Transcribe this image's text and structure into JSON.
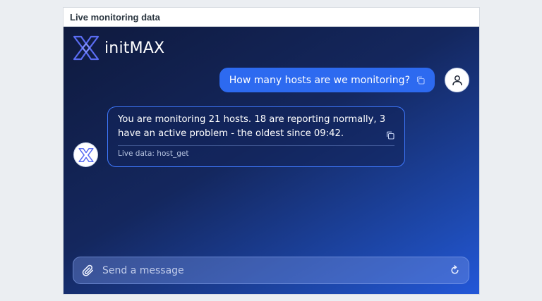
{
  "widget": {
    "title": "Live monitoring data"
  },
  "brand": {
    "name": "initMAX"
  },
  "conversation": {
    "user_message": "How many hosts are we monitoring?",
    "bot_message": "You are monitoring 21 hosts. 18 are reporting normally, 3 have an active problem - the oldest since 09:42.",
    "bot_source": "Live data: host_get"
  },
  "composer": {
    "placeholder": "Send a message"
  },
  "icons": {
    "logo": "initmax-logo-icon",
    "copy": "copy-icon",
    "user": "user-icon",
    "attach": "paperclip-icon",
    "reset": "refresh-icon"
  },
  "colors": {
    "accent": "#2d6af0",
    "bubble_border": "#3f79ff",
    "background_dark": "#0f1a3e",
    "background_light": "#2357d8"
  }
}
